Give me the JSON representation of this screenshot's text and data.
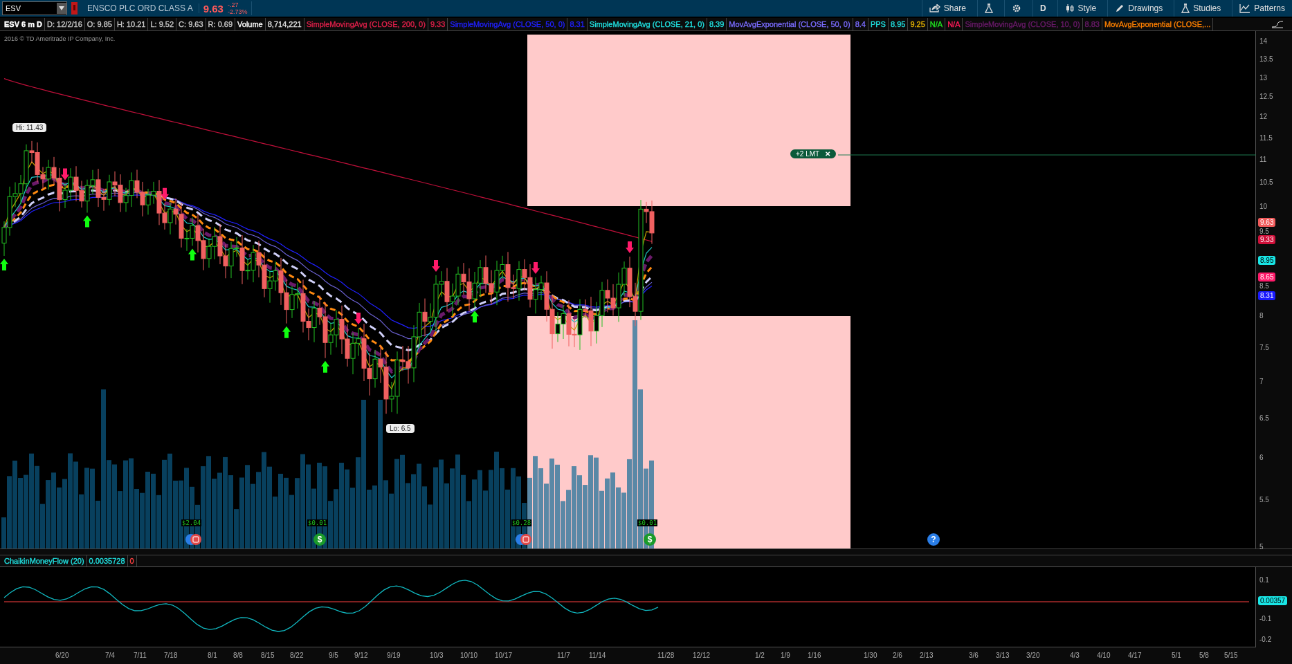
{
  "toolbar": {
    "symbol": "ESV",
    "description": "ENSCO PLC ORD CLASS A",
    "last": "9.63",
    "change": "-.27",
    "change_pct": "-2.73%",
    "buttons": [
      {
        "kind": "share",
        "label": "Share"
      },
      {
        "kind": "flask"
      },
      {
        "kind": "gear"
      },
      {
        "kind": "text",
        "label": "D"
      },
      {
        "kind": "style",
        "label": "Style"
      },
      {
        "kind": "drawings",
        "label": "Drawings"
      },
      {
        "kind": "studies",
        "label": "Studies"
      },
      {
        "kind": "patterns",
        "label": "Patterns"
      }
    ]
  },
  "legend": [
    {
      "kind": "title",
      "text": "ESV 6 m D",
      "color": "#ffffff"
    },
    {
      "kind": "field",
      "text": "D: 12/2/16",
      "color": "#c8c8c8"
    },
    {
      "kind": "field",
      "text": "O: 9.85",
      "color": "#c8c8c8"
    },
    {
      "kind": "field",
      "text": "H: 10.21",
      "color": "#c8c8c8"
    },
    {
      "kind": "field",
      "text": "L: 9.52",
      "color": "#c8c8c8"
    },
    {
      "kind": "field",
      "text": "C: 9.63",
      "color": "#c8c8c8"
    },
    {
      "kind": "field",
      "text": "R: 0.69",
      "color": "#c8c8c8"
    },
    {
      "kind": "field",
      "text": "Volume",
      "color": "#ffffff"
    },
    {
      "kind": "field",
      "text": "8,714,221",
      "color": "#e0e0e0"
    },
    {
      "kind": "field",
      "text": "SimpleMovingAvg (CLOSE, 200, 0)",
      "color": "#e0204a"
    },
    {
      "kind": "field",
      "text": "9.33",
      "color": "#e0204a"
    },
    {
      "kind": "field",
      "text": "SimpleMovingAvg (CLOSE, 50, 0)",
      "color": "#2020ff"
    },
    {
      "kind": "field",
      "text": "8.31",
      "color": "#2020ff"
    },
    {
      "kind": "field",
      "text": "SimpleMovingAvg (CLOSE, 21, 0)",
      "color": "#20e0e0"
    },
    {
      "kind": "field",
      "text": "8.39",
      "color": "#20e0e0"
    },
    {
      "kind": "field",
      "text": "MovAvgExponential (CLOSE, 50, 0)",
      "color": "#7a6cff"
    },
    {
      "kind": "field",
      "text": "8.4",
      "color": "#7a6cff"
    },
    {
      "kind": "field",
      "text": "PPS",
      "color": "#20e0e0"
    },
    {
      "kind": "field",
      "text": "8.95",
      "color": "#20e0e0"
    },
    {
      "kind": "field",
      "text": "9.25",
      "color": "#e8b400"
    },
    {
      "kind": "field",
      "text": "N/A",
      "color": "#20e020"
    },
    {
      "kind": "field",
      "text": "N/A",
      "color": "#ff1a5a"
    },
    {
      "kind": "field",
      "text": "SimpleMovingAvg (CLOSE, 10, 0)",
      "color": "#6a1a6a"
    },
    {
      "kind": "field",
      "text": "8.83",
      "color": "#6a1a6a"
    },
    {
      "kind": "field",
      "text": "MovAvgExponential (CLOSE,...",
      "color": "#ff8000"
    }
  ],
  "copyright": "2016 © TD Ameritrade IP Company, Inc.",
  "price_axis": {
    "labels": [
      "14",
      "13.5",
      "13",
      "12.5",
      "12",
      "11.5",
      "11",
      "10.5",
      "10",
      "9.5",
      "8.5",
      "8",
      "7.5",
      "7",
      "6.5",
      "6",
      "5.5",
      "5"
    ],
    "badges": [
      {
        "text": "9.63",
        "color": "#f05a5a"
      },
      {
        "text": "9.33",
        "color": "#d0103a"
      },
      {
        "text": "8.95",
        "color": "#19e6e6"
      },
      {
        "text": "8.65",
        "color": "#ff1a6a"
      },
      {
        "text": "8.31",
        "color": "#1a1aff"
      }
    ]
  },
  "chart": {
    "hi_label": "Hi: 11.43",
    "lo_label": "Lo: 6.5",
    "order": {
      "label": "+2 LMT",
      "close": "✕"
    },
    "events": [
      {
        "kind": "earnings",
        "label": "$2.04"
      },
      {
        "kind": "dividend",
        "label": "$0.01",
        "glyph": "$"
      },
      {
        "kind": "earnings",
        "label": "$0.28"
      },
      {
        "kind": "dividend",
        "label": "$0.01",
        "glyph": "$"
      },
      {
        "kind": "question",
        "glyph": "?"
      }
    ]
  },
  "lower_panel": {
    "study": "ChaikinMoneyFlow (20)",
    "value": "0.0035728",
    "extra": "0",
    "axis_labels": [
      "0.1",
      "-0.1",
      "-0.2"
    ],
    "badge": "0.00357"
  },
  "date_axis": [
    "6/20",
    "7/4",
    "7/11",
    "7/18",
    "8/1",
    "8/8",
    "8/15",
    "8/22",
    "9/5",
    "9/12",
    "9/19",
    "10/3",
    "10/10",
    "10/17",
    "11/7",
    "11/14",
    "11/28",
    "12/12",
    "1/2",
    "1/9",
    "1/16",
    "1/30",
    "2/6",
    "2/13",
    "3/6",
    "3/13",
    "3/20",
    "4/3",
    "4/10",
    "4/17",
    "5/1",
    "5/8",
    "5/15"
  ]
}
